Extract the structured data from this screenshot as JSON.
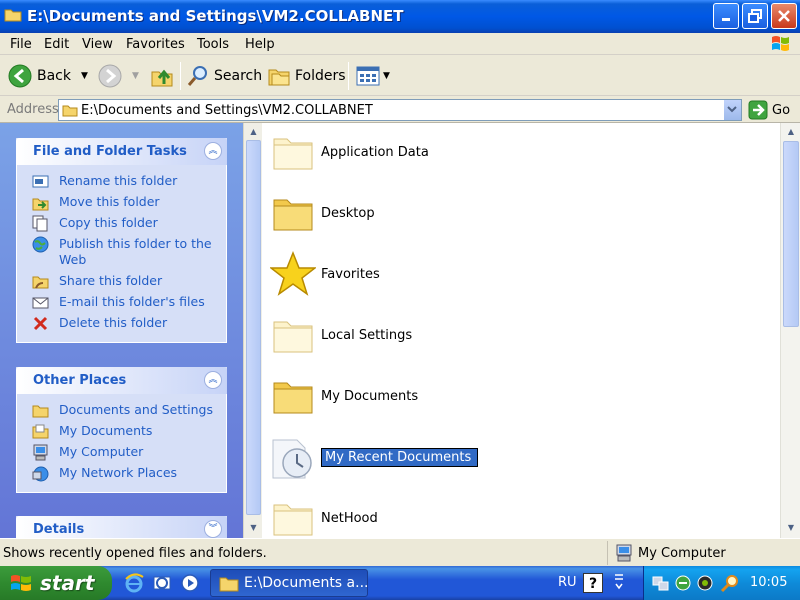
{
  "window": {
    "title": "E:\\Documents and Settings\\VM2.COLLABNET"
  },
  "menu": [
    "File",
    "Edit",
    "View",
    "Favorites",
    "Tools",
    "Help"
  ],
  "toolbar": {
    "back": "Back",
    "search": "Search",
    "folders": "Folders"
  },
  "address": {
    "label": "Address",
    "value": "E:\\Documents and Settings\\VM2.COLLABNET",
    "go": "Go"
  },
  "tasks": {
    "title": "File and Folder Tasks",
    "items": [
      {
        "label": "Rename this folder",
        "icon": "rename-icon"
      },
      {
        "label": "Move this folder",
        "icon": "move-icon"
      },
      {
        "label": "Copy this folder",
        "icon": "copy-icon"
      },
      {
        "label": "Publish this folder to the Web",
        "icon": "publish-icon"
      },
      {
        "label": "Share this folder",
        "icon": "share-icon"
      },
      {
        "label": "E-mail this folder's files",
        "icon": "email-icon"
      },
      {
        "label": "Delete this folder",
        "icon": "delete-icon"
      }
    ]
  },
  "places": {
    "title": "Other Places",
    "items": [
      {
        "label": "Documents and Settings",
        "icon": "folder-icon"
      },
      {
        "label": "My Documents",
        "icon": "my-documents-icon"
      },
      {
        "label": "My Computer",
        "icon": "my-computer-icon"
      },
      {
        "label": "My Network Places",
        "icon": "network-places-icon"
      }
    ]
  },
  "details": {
    "title": "Details"
  },
  "files": [
    {
      "name": "Application Data",
      "icon": "faded-folder-icon"
    },
    {
      "name": "Desktop",
      "icon": "folder-icon"
    },
    {
      "name": "Favorites",
      "icon": "favorites-star-icon"
    },
    {
      "name": "Local Settings",
      "icon": "faded-folder-icon"
    },
    {
      "name": "My Documents",
      "icon": "folder-icon"
    },
    {
      "name": "My Recent Documents",
      "icon": "recent-documents-icon",
      "editing": true
    },
    {
      "name": "NetHood",
      "icon": "faded-folder-icon"
    }
  ],
  "status": {
    "text": "Shows recently opened files and folders.",
    "zone": "My Computer"
  },
  "taskbar": {
    "start": "start",
    "window_button": "E:\\Documents a...",
    "language": "RU",
    "help": "?",
    "clock": "10:05"
  },
  "colors": {
    "titlebar": "#0058e6",
    "link": "#215dc6",
    "selection": "#316ac5",
    "start": "#2f8a2f"
  }
}
